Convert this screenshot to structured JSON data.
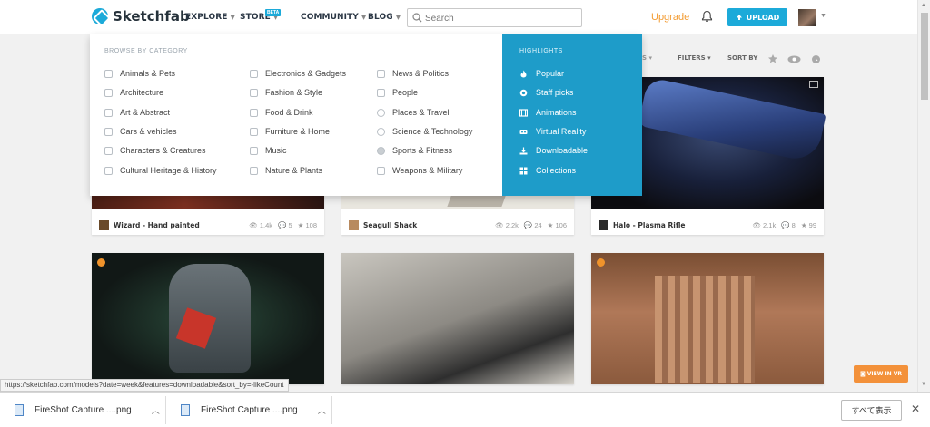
{
  "header": {
    "logo_text": "Sketchfab",
    "nav": [
      {
        "label": "EXPLORE"
      },
      {
        "label": "STORE",
        "badge": "BETA"
      },
      {
        "label": "COMMUNITY"
      },
      {
        "label": "BLOG"
      }
    ],
    "search_placeholder": "Search",
    "upgrade_label": "Upgrade",
    "upload_label": "UPLOAD",
    "colors": {
      "accent": "#1caad9",
      "upgrade": "#f39c33"
    }
  },
  "explore_menu": {
    "category_header": "BROWSE BY CATEGORY",
    "categories": [
      {
        "label": "Animals & Pets",
        "icon": "paw-icon"
      },
      {
        "label": "Architecture",
        "icon": "building-icon"
      },
      {
        "label": "Art & Abstract",
        "icon": "palette-icon"
      },
      {
        "label": "Cars & vehicles",
        "icon": "car-icon"
      },
      {
        "label": "Characters & Creatures",
        "icon": "figure-icon"
      },
      {
        "label": "Cultural Heritage & History",
        "icon": "museum-icon"
      },
      {
        "label": "Electronics & Gadgets",
        "icon": "chip-icon"
      },
      {
        "label": "Fashion & Style",
        "icon": "hanger-icon"
      },
      {
        "label": "Food & Drink",
        "icon": "food-icon"
      },
      {
        "label": "Furniture & Home",
        "icon": "lamp-icon"
      },
      {
        "label": "Music",
        "icon": "headphones-icon"
      },
      {
        "label": "Nature & Plants",
        "icon": "leaf-icon"
      },
      {
        "label": "News & Politics",
        "icon": "newspaper-icon"
      },
      {
        "label": "People",
        "icon": "people-icon"
      },
      {
        "label": "Places & Travel",
        "icon": "globe-icon"
      },
      {
        "label": "Science & Technology",
        "icon": "atom-icon"
      },
      {
        "label": "Sports & Fitness",
        "icon": "ball-icon"
      },
      {
        "label": "Weapons & Military",
        "icon": "weapon-icon"
      }
    ],
    "highlights_header": "HIGHLIGHTS",
    "highlights": [
      {
        "label": "Popular",
        "icon": "flame-icon"
      },
      {
        "label": "Staff picks",
        "icon": "badge-icon"
      },
      {
        "label": "Animations",
        "icon": "film-icon"
      },
      {
        "label": "Virtual Reality",
        "icon": "vr-icon"
      },
      {
        "label": "Downloadable",
        "icon": "download-icon"
      },
      {
        "label": "Collections",
        "icon": "grid-icon"
      }
    ],
    "highlight_color": "#1e9cc9"
  },
  "sort_bar": {
    "filters_label": "FILTERS",
    "sort_label": "SORT BY"
  },
  "models": [
    {
      "name": "Wizard - Hand painted",
      "views": "1.4k",
      "comments": "5",
      "likes": "108"
    },
    {
      "name": "Seagull Shack",
      "views": "2.2k",
      "comments": "24",
      "likes": "106"
    },
    {
      "name": "Halo - Plasma Rifle",
      "views": "2.1k",
      "comments": "8",
      "likes": "99"
    }
  ],
  "status_url": "https://sketchfab.com/models?date=week&features=downloadable&sort_by=-likeCount",
  "vr_button_label": "VIEW IN VR",
  "downloads": [
    {
      "name": "FireShot Capture ....png"
    },
    {
      "name": "FireShot Capture ....png"
    }
  ],
  "show_all_label": "すべて表示"
}
